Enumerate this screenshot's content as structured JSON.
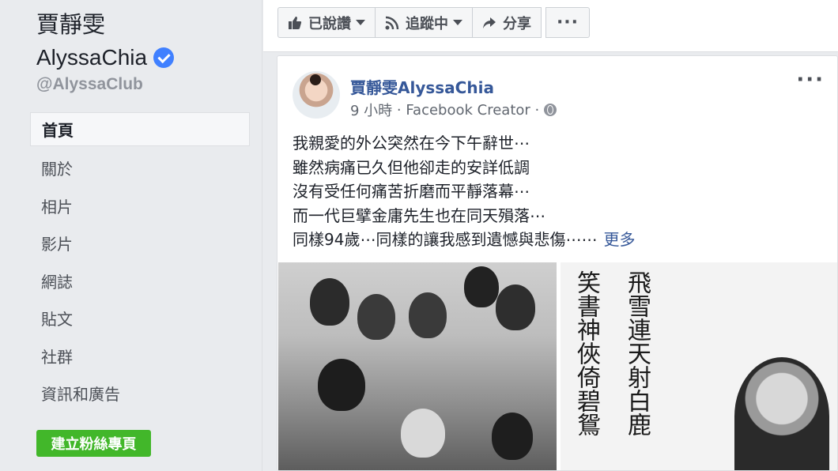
{
  "sidebar": {
    "page_name": "賈靜雯",
    "page_name_latin": "AlyssaChia",
    "handle": "@AlyssaClub",
    "nav": [
      {
        "label": "首頁",
        "active": true
      },
      {
        "label": "關於",
        "active": false
      },
      {
        "label": "相片",
        "active": false
      },
      {
        "label": "影片",
        "active": false
      },
      {
        "label": "網誌",
        "active": false
      },
      {
        "label": "貼文",
        "active": false
      },
      {
        "label": "社群",
        "active": false
      },
      {
        "label": "資訊和廣告",
        "active": false
      }
    ],
    "create_page_label": "建立粉絲專頁"
  },
  "topbar": {
    "liked_label": "已說讚",
    "following_label": "追蹤中",
    "share_label": "分享",
    "more_label": "···"
  },
  "post": {
    "author": "賈靜雯AlyssaChia",
    "time": "9 小時",
    "source": "Facebook Creator",
    "more_label": "···",
    "lines": [
      "我親愛的外公突然在今下午辭世⋯",
      "雖然病痛已久但他卻走的安詳低調",
      "沒有受任何痛苦折磨而平靜落幕⋯",
      "而一代巨擘金庸先生也在同天殞落⋯",
      "同樣94歲⋯同樣的讓我感到遺憾與悲傷⋯⋯"
    ],
    "see_more": "更多",
    "calligraphy_col1": "飛雪連天射白鹿",
    "calligraphy_col2": "笑書神俠倚碧鴛"
  },
  "colors": {
    "link": "#365899",
    "verified": "#4080ff",
    "create_button": "#42b72a"
  }
}
